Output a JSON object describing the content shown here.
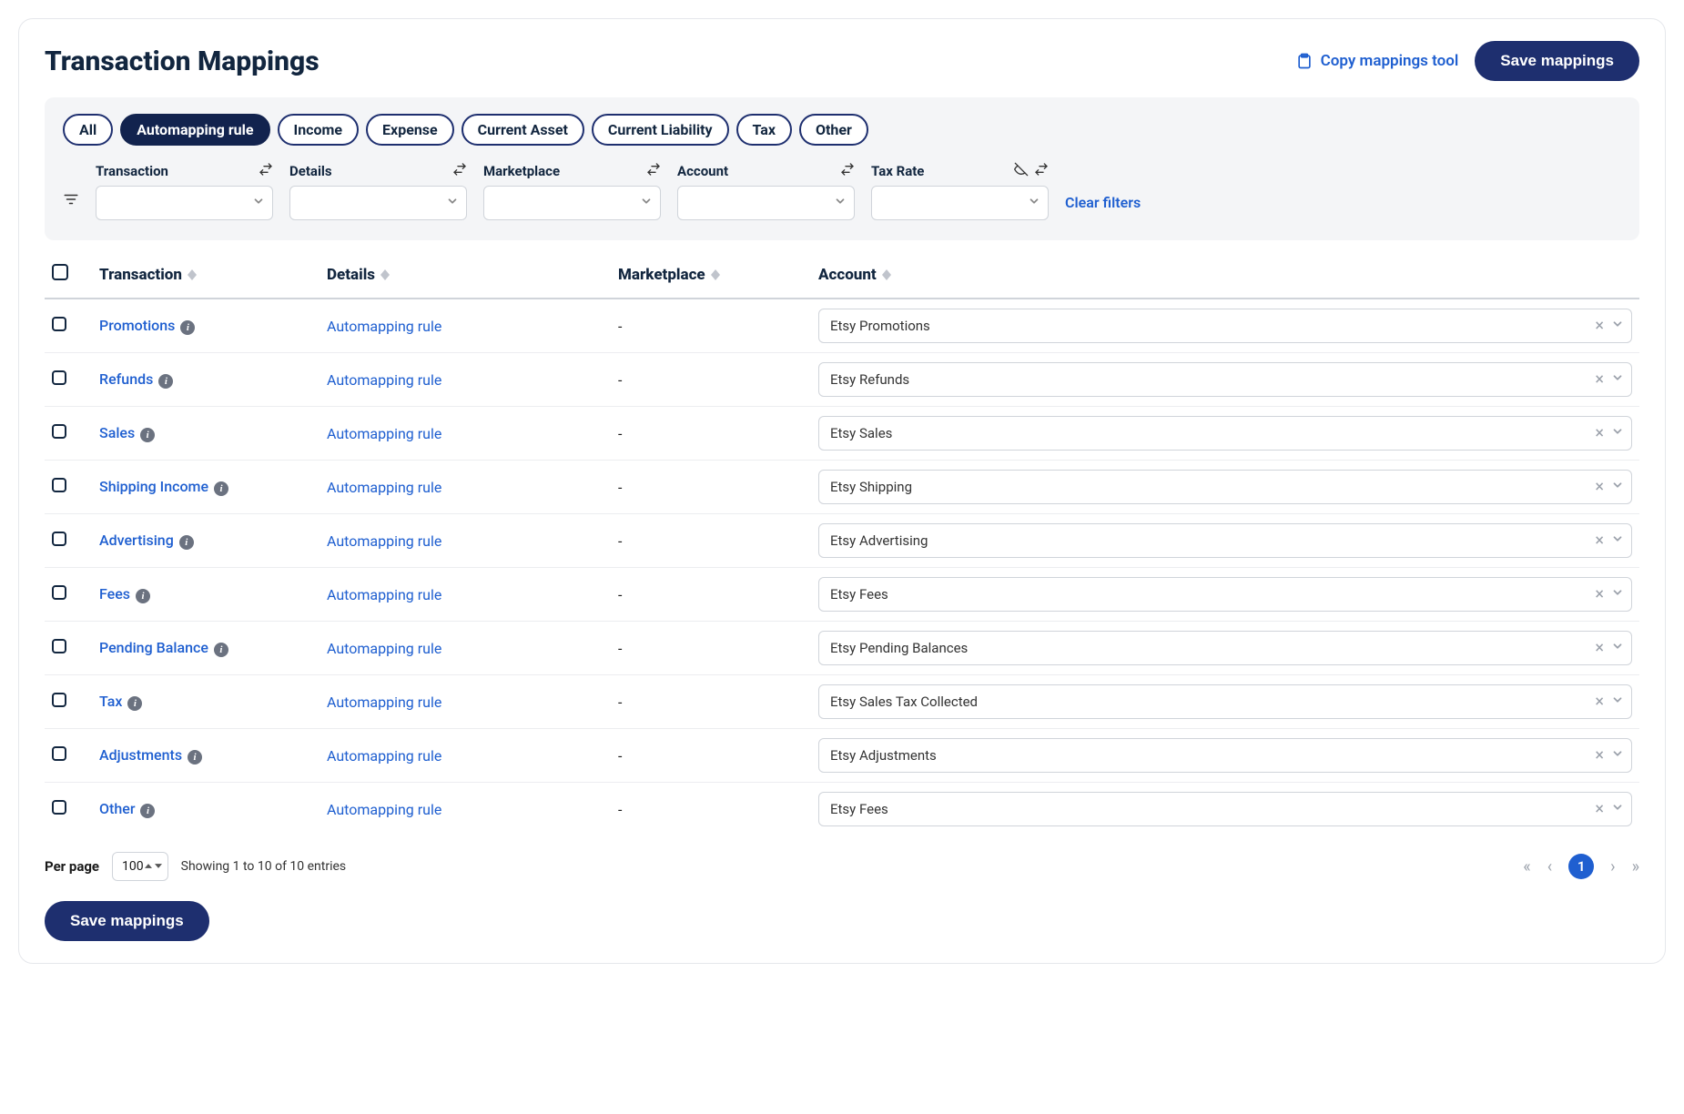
{
  "title": "Transaction Mappings",
  "header": {
    "copy_tool": "Copy mappings tool",
    "save": "Save mappings"
  },
  "chips": [
    {
      "label": "All",
      "active": false
    },
    {
      "label": "Automapping rule",
      "active": true
    },
    {
      "label": "Income",
      "active": false
    },
    {
      "label": "Expense",
      "active": false
    },
    {
      "label": "Current Asset",
      "active": false
    },
    {
      "label": "Current Liability",
      "active": false
    },
    {
      "label": "Tax",
      "active": false
    },
    {
      "label": "Other",
      "active": false
    }
  ],
  "filters": {
    "transaction": "Transaction",
    "details": "Details",
    "marketplace": "Marketplace",
    "account": "Account",
    "tax_rate": "Tax Rate",
    "clear": "Clear filters"
  },
  "columns": {
    "transaction": "Transaction",
    "details": "Details",
    "marketplace": "Marketplace",
    "account": "Account"
  },
  "rows": [
    {
      "transaction": "Promotions",
      "details": "Automapping rule",
      "marketplace": "-",
      "account": "Etsy Promotions"
    },
    {
      "transaction": "Refunds",
      "details": "Automapping rule",
      "marketplace": "-",
      "account": "Etsy Refunds"
    },
    {
      "transaction": "Sales",
      "details": "Automapping rule",
      "marketplace": "-",
      "account": "Etsy Sales"
    },
    {
      "transaction": "Shipping Income",
      "details": "Automapping rule",
      "marketplace": "-",
      "account": "Etsy Shipping"
    },
    {
      "transaction": "Advertising",
      "details": "Automapping rule",
      "marketplace": "-",
      "account": "Etsy Advertising"
    },
    {
      "transaction": "Fees",
      "details": "Automapping rule",
      "marketplace": "-",
      "account": "Etsy Fees"
    },
    {
      "transaction": "Pending Balance",
      "details": "Automapping rule",
      "marketplace": "-",
      "account": "Etsy Pending Balances"
    },
    {
      "transaction": "Tax",
      "details": "Automapping rule",
      "marketplace": "-",
      "account": "Etsy Sales Tax Collected"
    },
    {
      "transaction": "Adjustments",
      "details": "Automapping rule",
      "marketplace": "-",
      "account": "Etsy Adjustments"
    },
    {
      "transaction": "Other",
      "details": "Automapping rule",
      "marketplace": "-",
      "account": "Etsy Fees"
    }
  ],
  "footer": {
    "per_page_label": "Per page",
    "per_page_value": "100",
    "entries_text": "Showing 1 to 10 of 10 entries",
    "page": "1",
    "save": "Save mappings"
  }
}
